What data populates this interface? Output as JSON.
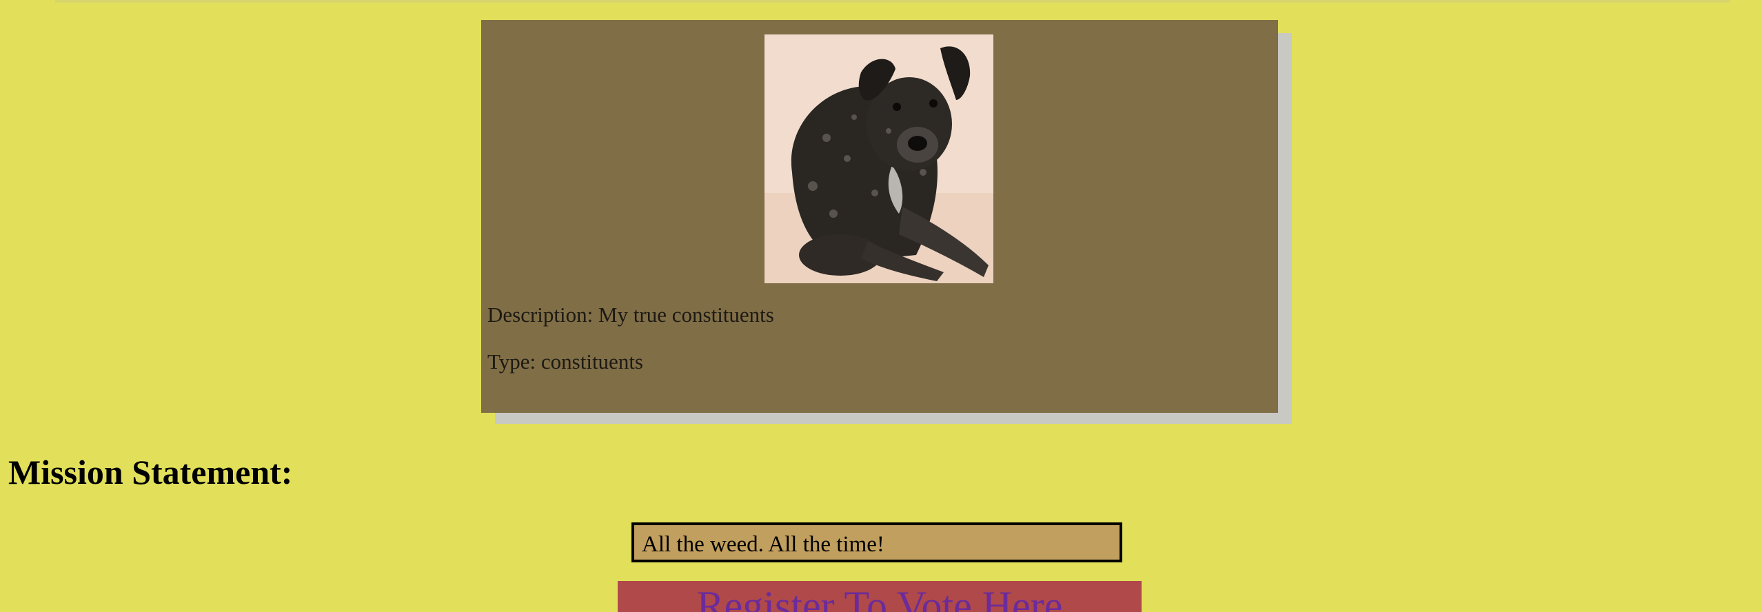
{
  "candidate_card": {
    "photo_icon": "dog-photo",
    "description": "Description: My true constituents",
    "type": "Type: constituents"
  },
  "mission": {
    "heading": "Mission Statement:",
    "statement": "All the weed. All the time!"
  },
  "register": {
    "label": "Register To Vote Here"
  },
  "colors": {
    "page_background": "#e2e05a",
    "card_background": "#806e46",
    "mission_box": "#c19f5e",
    "register_background": "#b0494a",
    "register_text": "#6b2b9b"
  }
}
